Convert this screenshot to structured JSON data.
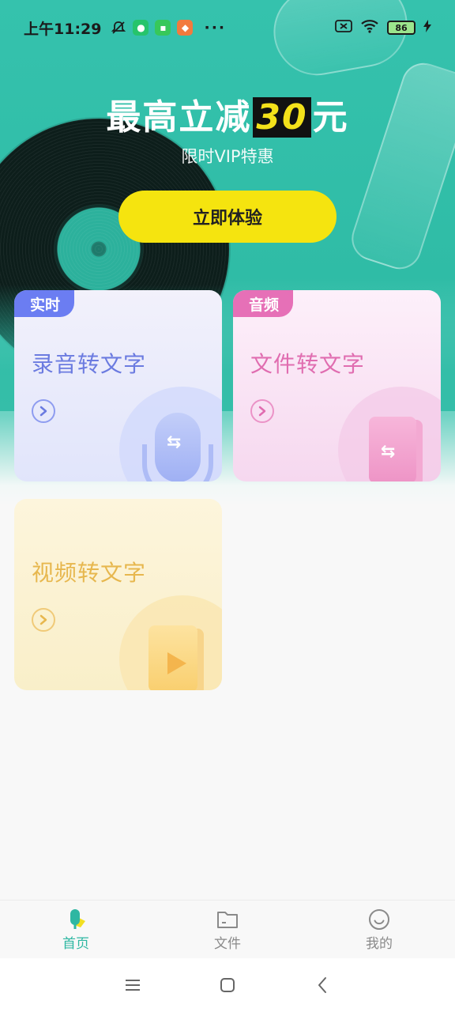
{
  "status_bar": {
    "time": "上午11:29",
    "battery": "86",
    "more": "···"
  },
  "promo": {
    "title_prefix": "最高立减",
    "title_number": "30",
    "title_suffix": "元",
    "subtitle": "限时VIP特惠",
    "cta_label": "立即体验"
  },
  "cards": [
    {
      "tag": "实时",
      "title": "录音转文字"
    },
    {
      "tag": "音频",
      "title": "文件转文字"
    },
    {
      "title": "视频转文字"
    }
  ],
  "nav": {
    "items": [
      {
        "label": "首页",
        "icon": "mic-icon",
        "active": true
      },
      {
        "label": "文件",
        "icon": "folder-icon",
        "active": false
      },
      {
        "label": "我的",
        "icon": "smile-icon",
        "active": false
      }
    ]
  },
  "colors": {
    "brand_teal": "#2eb7a2",
    "cta_yellow": "#f5e40f",
    "tag_blue": "#6b7df2",
    "tag_pink": "#e670b7",
    "video_gold": "#e7b74e"
  }
}
